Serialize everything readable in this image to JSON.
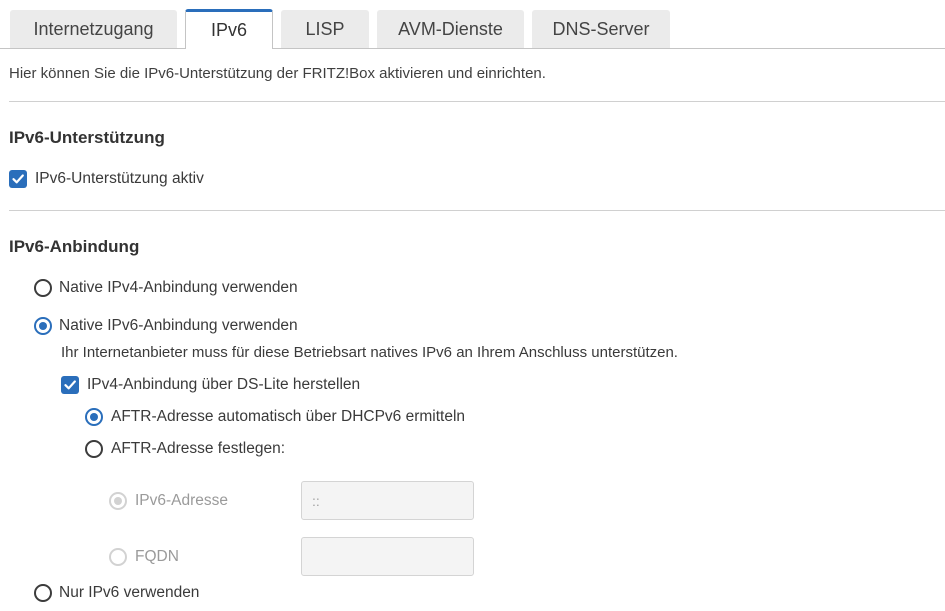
{
  "tabs": [
    {
      "label": "Internetzugang",
      "active": false
    },
    {
      "label": "IPv6",
      "active": true
    },
    {
      "label": "LISP",
      "active": false
    },
    {
      "label": "AVM-Dienste",
      "active": false
    },
    {
      "label": "DNS-Server",
      "active": false
    }
  ],
  "intro": "Hier können Sie die IPv6-Unterstützung der FRITZ!Box aktivieren und einrichten.",
  "support": {
    "title": "IPv6-Unterstützung",
    "checkbox_label": "IPv6-Unterstützung aktiv",
    "checked": true
  },
  "connection": {
    "title": "IPv6-Anbindung",
    "native_ipv4_label": "Native IPv4-Anbindung verwenden",
    "native_ipv6_label": "Native IPv6-Anbindung verwenden",
    "native_ipv6_hint": "Ihr Internetanbieter muss für diese Betriebsart natives IPv6 an Ihrem Anschluss unterstützen.",
    "dslite_label": "IPv4-Anbindung über DS-Lite herstellen",
    "aftr_auto_label": "AFTR-Adresse automatisch über DHCPv6 ermitteln",
    "aftr_manual_label": "AFTR-Adresse festlegen:",
    "ipv6_address_label": "IPv6-Adresse",
    "ipv6_address_value": "::",
    "fqdn_label": "FQDN",
    "fqdn_value": "",
    "ipv6_only_label": "Nur IPv6 verwenden"
  },
  "colors": {
    "accent": "#2a6ebb",
    "tab_inactive": "#ebebeb"
  },
  "icons": {
    "checkmark": "checkmark-icon"
  }
}
